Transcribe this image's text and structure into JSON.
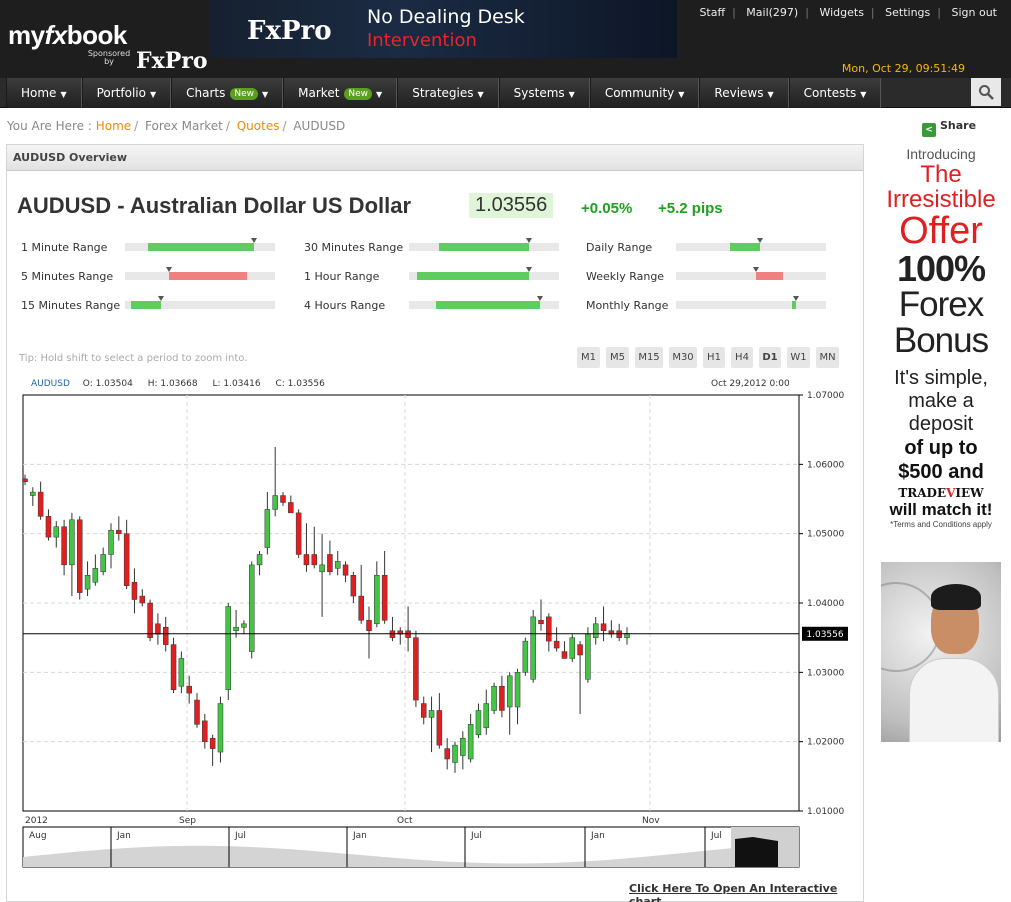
{
  "header": {
    "logo_pre": "my",
    "logo_fx": "fx",
    "logo_post": "book",
    "sponsored_text": "Sponsored by",
    "sponsor_brand": "FxPro",
    "banner": {
      "brand": "FxPro",
      "line1": "No Dealing Desk",
      "line2": "Intervention"
    },
    "links": [
      "Staff",
      "Mail(297)",
      "Widgets",
      "Settings",
      "Sign out"
    ],
    "datetime": "Mon, Oct 29, 09:51:49",
    "search_icon": "search-icon"
  },
  "nav": {
    "items": [
      {
        "label": "Home",
        "badge": ""
      },
      {
        "label": "Portfolio",
        "badge": ""
      },
      {
        "label": "Charts",
        "badge": "New"
      },
      {
        "label": "Market",
        "badge": "New"
      },
      {
        "label": "Strategies",
        "badge": ""
      },
      {
        "label": "Systems",
        "badge": ""
      },
      {
        "label": "Community",
        "badge": ""
      },
      {
        "label": "Reviews",
        "badge": ""
      },
      {
        "label": "Contests",
        "badge": ""
      }
    ],
    "arrow": "▼"
  },
  "breadcrumb": {
    "prefix": "You Are Here :",
    "home": "Home",
    "sep": "/",
    "forex": "Forex Market",
    "quotes": "Quotes",
    "current": "AUDUSD"
  },
  "share": {
    "label": "Share",
    "icon": "share-icon"
  },
  "overview": {
    "panel_title": "AUDUSD Overview",
    "instrument": "AUDUSD - Australian Dollar US Dollar",
    "price": "1.03556",
    "change_pct": "+0.05%",
    "change_pips": "+5.2 pips",
    "ranges": [
      {
        "label": "1 Minute Range",
        "from": 0.15,
        "to": 0.86,
        "marker": 0.86,
        "color": "#5fcc5f"
      },
      {
        "label": "30 Minutes Range",
        "from": 0.2,
        "to": 0.8,
        "marker": 0.8,
        "color": "#5fcc5f"
      },
      {
        "label": "Daily Range",
        "from": 0.36,
        "to": 0.56,
        "marker": 0.56,
        "color": "#5fcc5f"
      },
      {
        "label": "5 Minutes Range",
        "from": 0.29,
        "to": 0.81,
        "marker": 0.29,
        "color": "#f08080"
      },
      {
        "label": "1 Hour Range",
        "from": 0.05,
        "to": 0.8,
        "marker": 0.8,
        "color": "#5fcc5f"
      },
      {
        "label": "Weekly Range",
        "from": 0.53,
        "to": 0.71,
        "marker": 0.53,
        "color": "#f08080"
      },
      {
        "label": "15 Minutes Range",
        "from": 0.04,
        "to": 0.24,
        "marker": 0.24,
        "color": "#5fcc5f"
      },
      {
        "label": "4 Hours Range",
        "from": 0.18,
        "to": 0.87,
        "marker": 0.87,
        "color": "#5fcc5f"
      },
      {
        "label": "Monthly Range",
        "from": 0.77,
        "to": 0.8,
        "marker": 0.8,
        "color": "#5fcc5f"
      }
    ],
    "tip": "Tip: Hold shift to select a period to zoom into.",
    "timeframes": [
      "M1",
      "M5",
      "M15",
      "M30",
      "H1",
      "H4",
      "D1",
      "W1",
      "MN"
    ],
    "active_timeframe": "D1",
    "ohlc": {
      "symbol": "AUDUSD",
      "open": "O: 1.03504",
      "high": "H: 1.03668",
      "low": "L: 1.03416",
      "close": "C: 1.03556",
      "date": "Oct 29,2012 0:00"
    },
    "cta": "Click Here To Open An Interactive chart"
  },
  "chart_data": {
    "type": "candlestick",
    "y_ticks": [
      "1.07000",
      "1.06000",
      "1.05000",
      "1.04000",
      "1.03000",
      "1.02000",
      "1.01000"
    ],
    "ylim": [
      1.01,
      1.07
    ],
    "x_labels": [
      "2012",
      "Sep",
      "Oct",
      "Nov"
    ],
    "last_price_label": "1.03556",
    "last_price": 1.03556,
    "candles": [
      {
        "o": 1.0579,
        "h": 1.0585,
        "l": 1.057,
        "c": 1.0575
      },
      {
        "o": 1.0555,
        "h": 1.0567,
        "l": 1.054,
        "c": 1.056
      },
      {
        "o": 1.056,
        "h": 1.0575,
        "l": 1.052,
        "c": 1.0525
      },
      {
        "o": 1.0525,
        "h": 1.0535,
        "l": 1.049,
        "c": 1.0495
      },
      {
        "o": 1.0495,
        "h": 1.0518,
        "l": 1.048,
        "c": 1.051
      },
      {
        "o": 1.051,
        "h": 1.052,
        "l": 1.044,
        "c": 1.0455
      },
      {
        "o": 1.0455,
        "h": 1.053,
        "l": 1.041,
        "c": 1.052
      },
      {
        "o": 1.052,
        "h": 1.0525,
        "l": 1.0405,
        "c": 1.0415
      },
      {
        "o": 1.042,
        "h": 1.046,
        "l": 1.041,
        "c": 1.044
      },
      {
        "o": 1.043,
        "h": 1.047,
        "l": 1.0425,
        "c": 1.045
      },
      {
        "o": 1.0445,
        "h": 1.048,
        "l": 1.044,
        "c": 1.047
      },
      {
        "o": 1.047,
        "h": 1.0515,
        "l": 1.045,
        "c": 1.0505
      },
      {
        "o": 1.0505,
        "h": 1.0525,
        "l": 1.049,
        "c": 1.05
      },
      {
        "o": 1.05,
        "h": 1.052,
        "l": 1.042,
        "c": 1.0425
      },
      {
        "o": 1.043,
        "h": 1.045,
        "l": 1.0385,
        "c": 1.0405
      },
      {
        "o": 1.041,
        "h": 1.042,
        "l": 1.0395,
        "c": 1.04
      },
      {
        "o": 1.04,
        "h": 1.0405,
        "l": 1.0345,
        "c": 1.035
      },
      {
        "o": 1.037,
        "h": 1.0385,
        "l": 1.034,
        "c": 1.0355
      },
      {
        "o": 1.0365,
        "h": 1.038,
        "l": 1.033,
        "c": 1.034
      },
      {
        "o": 1.034,
        "h": 1.035,
        "l": 1.027,
        "c": 1.0275
      },
      {
        "o": 1.028,
        "h": 1.033,
        "l": 1.027,
        "c": 1.032
      },
      {
        "o": 1.028,
        "h": 1.0295,
        "l": 1.0255,
        "c": 1.027
      },
      {
        "o": 1.026,
        "h": 1.027,
        "l": 1.022,
        "c": 1.0225
      },
      {
        "o": 1.023,
        "h": 1.024,
        "l": 1.019,
        "c": 1.02
      },
      {
        "o": 1.0205,
        "h": 1.021,
        "l": 1.0165,
        "c": 1.019
      },
      {
        "o": 1.0185,
        "h": 1.0265,
        "l": 1.017,
        "c": 1.0255
      },
      {
        "o": 1.0275,
        "h": 1.04,
        "l": 1.026,
        "c": 1.0395
      },
      {
        "o": 1.036,
        "h": 1.039,
        "l": 1.035,
        "c": 1.0365
      },
      {
        "o": 1.0365,
        "h": 1.0375,
        "l": 1.0355,
        "c": 1.037
      },
      {
        "o": 1.033,
        "h": 1.046,
        "l": 1.032,
        "c": 1.0455
      },
      {
        "o": 1.0455,
        "h": 1.0475,
        "l": 1.044,
        "c": 1.047
      },
      {
        "o": 1.048,
        "h": 1.056,
        "l": 1.047,
        "c": 1.0535
      },
      {
        "o": 1.0535,
        "h": 1.0625,
        "l": 1.0525,
        "c": 1.0555
      },
      {
        "o": 1.0555,
        "h": 1.056,
        "l": 1.054,
        "c": 1.0545
      },
      {
        "o": 1.0545,
        "h": 1.0555,
        "l": 1.0535,
        "c": 1.053
      },
      {
        "o": 1.053,
        "h": 1.0535,
        "l": 1.0465,
        "c": 1.047
      },
      {
        "o": 1.047,
        "h": 1.0515,
        "l": 1.0445,
        "c": 1.0455
      },
      {
        "o": 1.047,
        "h": 1.051,
        "l": 1.045,
        "c": 1.0455
      },
      {
        "o": 1.0445,
        "h": 1.05,
        "l": 1.038,
        "c": 1.0455
      },
      {
        "o": 1.047,
        "h": 1.049,
        "l": 1.044,
        "c": 1.0445
      },
      {
        "o": 1.045,
        "h": 1.0475,
        "l": 1.044,
        "c": 1.046
      },
      {
        "o": 1.0455,
        "h": 1.046,
        "l": 1.043,
        "c": 1.044
      },
      {
        "o": 1.044,
        "h": 1.0445,
        "l": 1.04,
        "c": 1.041
      },
      {
        "o": 1.041,
        "h": 1.0455,
        "l": 1.037,
        "c": 1.0375
      },
      {
        "o": 1.0375,
        "h": 1.0395,
        "l": 1.032,
        "c": 1.036
      },
      {
        "o": 1.037,
        "h": 1.046,
        "l": 1.0365,
        "c": 1.044
      },
      {
        "o": 1.044,
        "h": 1.0475,
        "l": 1.037,
        "c": 1.0375
      },
      {
        "o": 1.036,
        "h": 1.038,
        "l": 1.0345,
        "c": 1.035
      },
      {
        "o": 1.036,
        "h": 1.0365,
        "l": 1.034,
        "c": 1.0355
      },
      {
        "o": 1.036,
        "h": 1.0395,
        "l": 1.033,
        "c": 1.035
      },
      {
        "o": 1.035,
        "h": 1.036,
        "l": 1.025,
        "c": 1.026
      },
      {
        "o": 1.0255,
        "h": 1.0265,
        "l": 1.0225,
        "c": 1.0235
      },
      {
        "o": 1.0235,
        "h": 1.0265,
        "l": 1.0185,
        "c": 1.0245
      },
      {
        "o": 1.0245,
        "h": 1.027,
        "l": 1.019,
        "c": 1.0195
      },
      {
        "o": 1.019,
        "h": 1.0205,
        "l": 1.016,
        "c": 1.0175
      },
      {
        "o": 1.017,
        "h": 1.02,
        "l": 1.0155,
        "c": 1.0195
      },
      {
        "o": 1.018,
        "h": 1.0215,
        "l": 1.016,
        "c": 1.0205
      },
      {
        "o": 1.0175,
        "h": 1.024,
        "l": 1.017,
        "c": 1.0225
      },
      {
        "o": 1.021,
        "h": 1.0255,
        "l": 1.0205,
        "c": 1.0245
      },
      {
        "o": 1.022,
        "h": 1.0275,
        "l": 1.021,
        "c": 1.0255
      },
      {
        "o": 1.0245,
        "h": 1.0285,
        "l": 1.024,
        "c": 1.028
      },
      {
        "o": 1.028,
        "h": 1.0295,
        "l": 1.0235,
        "c": 1.0245
      },
      {
        "o": 1.025,
        "h": 1.03,
        "l": 1.021,
        "c": 1.0295
      },
      {
        "o": 1.025,
        "h": 1.0305,
        "l": 1.0225,
        "c": 1.03
      },
      {
        "o": 1.03,
        "h": 1.035,
        "l": 1.0295,
        "c": 1.0345
      },
      {
        "o": 1.029,
        "h": 1.039,
        "l": 1.0285,
        "c": 1.038
      },
      {
        "o": 1.0375,
        "h": 1.0405,
        "l": 1.036,
        "c": 1.037
      },
      {
        "o": 1.038,
        "h": 1.0385,
        "l": 1.033,
        "c": 1.0345
      },
      {
        "o": 1.0345,
        "h": 1.0365,
        "l": 1.033,
        "c": 1.0335
      },
      {
        "o": 1.033,
        "h": 1.0345,
        "l": 1.032,
        "c": 1.032
      },
      {
        "o": 1.032,
        "h": 1.0355,
        "l": 1.0315,
        "c": 1.035
      },
      {
        "o": 1.034,
        "h": 1.0345,
        "l": 1.024,
        "c": 1.0325
      },
      {
        "o": 1.029,
        "h": 1.0365,
        "l": 1.0285,
        "c": 1.0355
      },
      {
        "o": 1.035,
        "h": 1.038,
        "l": 1.034,
        "c": 1.037
      },
      {
        "o": 1.037,
        "h": 1.0395,
        "l": 1.0345,
        "c": 1.036
      },
      {
        "o": 1.036,
        "h": 1.0375,
        "l": 1.035,
        "c": 1.0355
      },
      {
        "o": 1.036,
        "h": 1.037,
        "l": 1.0345,
        "c": 1.035
      },
      {
        "o": 1.035,
        "h": 1.0365,
        "l": 1.034,
        "c": 1.0356
      }
    ],
    "navigator_labels": [
      "Aug",
      "Jan",
      "Jul",
      "Jan",
      "Jul",
      "Jan",
      "Jul"
    ]
  },
  "ad": {
    "line1": "Introducing",
    "line2": "The",
    "line3": "Irresistible",
    "line4": "Offer",
    "line5": "100%",
    "line6": "Forex",
    "line7": "Bonus",
    "line8": "It's simple,",
    "line9": "make a",
    "line10": "deposit",
    "line11": "of up to",
    "line12": "$500 and",
    "brand_pre": "TRADE",
    "brand_v": "V",
    "brand_post": "IEW",
    "line13": "will match it!",
    "line14": "*Terms and Conditions apply"
  }
}
